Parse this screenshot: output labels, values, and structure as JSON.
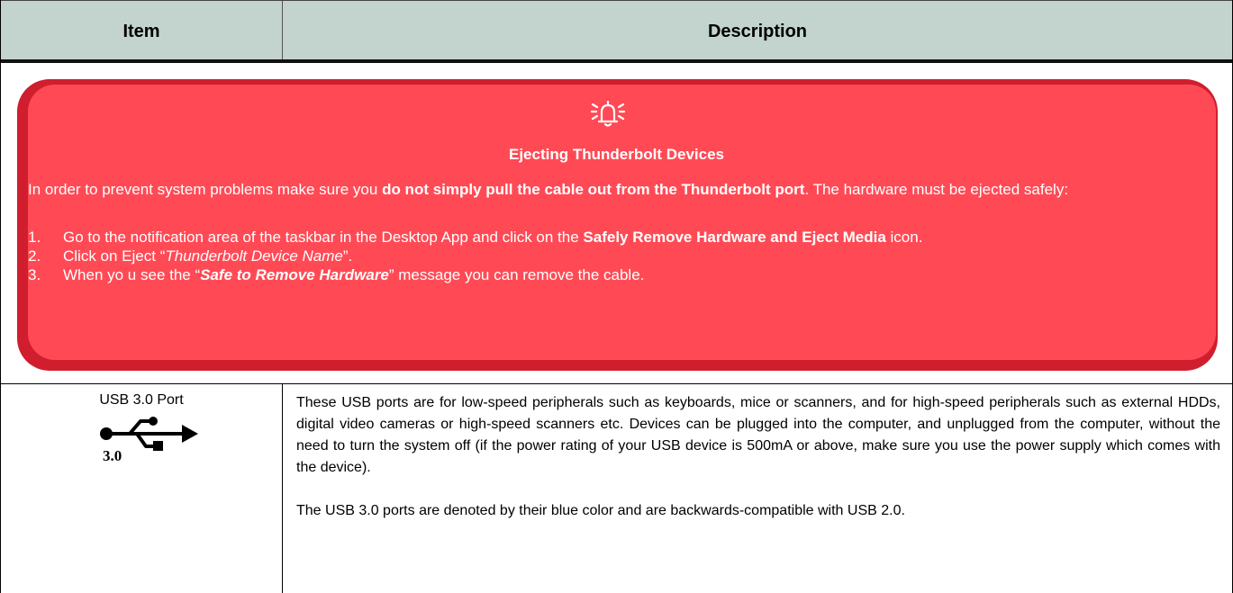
{
  "table": {
    "header": {
      "item": "Item",
      "description": "Description"
    }
  },
  "warning": {
    "icon": "bell-warning-icon",
    "title": "Ejecting Thunderbolt Devices",
    "intro_pre": "In order to prevent system problems make sure you ",
    "intro_bold": "do not simply pull the cable out from the Thunderbolt port",
    "intro_post": ". The hardware must be ejected safely:",
    "steps": [
      {
        "num": "1.",
        "pre": "Go to the notification area of the taskbar in the Desktop App and click on the ",
        "bold": "Safely Remove Hardware and Eject Media",
        "post": " icon."
      },
      {
        "num": "2.",
        "pre": "Click on Eject “",
        "italic": "Thunderbolt Device Name",
        "post": "”."
      },
      {
        "num": "3.",
        "pre": "When yo u see the “",
        "bolditalic": "Safe to Remove Hardware",
        "post": "” message you can remove the cable."
      }
    ],
    "colors": {
      "outer": "#d01e2e",
      "inner": "#ff4a55",
      "text": "#ffffff"
    }
  },
  "usb": {
    "label": "USB 3.0 Port",
    "icon": "usb-3.0-icon",
    "icon_caption": "3.0",
    "paragraphs": [
      "These USB ports are for low-speed peripherals such as keyboards, mice or scanners, and for high-speed peripherals such as external HDDs, digital video cameras or high-speed scanners etc. Devices can be plugged into the computer, and unplugged from the computer, without the need to turn the system off (if the power rating of your USB device is 500mA or above, make sure you use the power supply which comes with the device).",
      "The USB 3.0 ports are denoted by their blue color and are backwards-compatible with USB 2.0."
    ]
  },
  "colors": {
    "header_bg": "#c3d3cd"
  }
}
